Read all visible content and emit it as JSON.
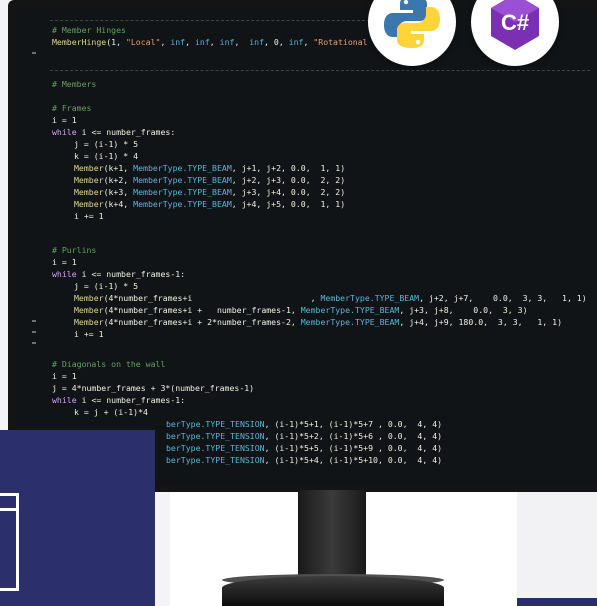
{
  "editor": {
    "lines": [
      {
        "parts": [
          {
            "cls": "c",
            "text": "# Member Hinges"
          }
        ]
      },
      {
        "parts": [
          {
            "cls": "f",
            "text": "MemberHinge"
          },
          {
            "cls": "v",
            "text": "(1, "
          },
          {
            "cls": "s",
            "text": "\"Local\""
          },
          {
            "cls": "v",
            "text": ", "
          },
          {
            "cls": "t",
            "text": "inf"
          },
          {
            "cls": "v",
            "text": ", "
          },
          {
            "cls": "t",
            "text": "inf"
          },
          {
            "cls": "v",
            "text": ", "
          },
          {
            "cls": "t",
            "text": "inf"
          },
          {
            "cls": "v",
            "text": ",  "
          },
          {
            "cls": "t",
            "text": "inf"
          },
          {
            "cls": "v",
            "text": ", 0, "
          },
          {
            "cls": "t",
            "text": "inf"
          },
          {
            "cls": "v",
            "text": ", "
          },
          {
            "cls": "s",
            "text": "\"Rotational            ly\""
          },
          {
            "cls": "v",
            "text": ")"
          }
        ]
      },
      {
        "parts": [
          {
            "cls": "c",
            "text": "# Members"
          }
        ]
      },
      {
        "parts": [
          {
            "cls": "c",
            "text": "# Frames"
          }
        ]
      },
      {
        "parts": [
          {
            "cls": "v",
            "text": "i = 1"
          }
        ]
      },
      {
        "parts": [
          {
            "cls": "k",
            "text": "while"
          },
          {
            "cls": "v",
            "text": " i <= number_frames:"
          }
        ]
      },
      {
        "parts": [
          {
            "cls": "v",
            "text": "j = (i-1) * 5"
          }
        ]
      },
      {
        "parts": [
          {
            "cls": "v",
            "text": "k = (i-1) * 4"
          }
        ]
      },
      {
        "parts": [
          {
            "cls": "f",
            "text": "Member"
          },
          {
            "cls": "v",
            "text": "(k+1, "
          },
          {
            "cls": "t",
            "text": "MemberType.TYPE_BEAM"
          },
          {
            "cls": "v",
            "text": ", j+1, j+2, 0.0,  1, 1)"
          }
        ]
      },
      {
        "parts": [
          {
            "cls": "f",
            "text": "Member"
          },
          {
            "cls": "v",
            "text": "(k+2, "
          },
          {
            "cls": "t",
            "text": "MemberType.TYPE_BEAM"
          },
          {
            "cls": "v",
            "text": ", j+2, j+3, 0.0,  2, 2)"
          }
        ]
      },
      {
        "parts": [
          {
            "cls": "f",
            "text": "Member"
          },
          {
            "cls": "v",
            "text": "(k+3, "
          },
          {
            "cls": "t",
            "text": "MemberType.TYPE_BEAM"
          },
          {
            "cls": "v",
            "text": ", j+3, j+4, 0.0,  2, 2)"
          }
        ]
      },
      {
        "parts": [
          {
            "cls": "f",
            "text": "Member"
          },
          {
            "cls": "v",
            "text": "(k+4, "
          },
          {
            "cls": "t",
            "text": "MemberType.TYPE_BEAM"
          },
          {
            "cls": "v",
            "text": ", j+4, j+5, 0.0,  1, 1)"
          }
        ]
      },
      {
        "parts": [
          {
            "cls": "v",
            "text": "i += 1"
          }
        ]
      },
      {
        "parts": [
          {
            "cls": "c",
            "text": "# Purlins"
          }
        ]
      },
      {
        "parts": [
          {
            "cls": "v",
            "text": "i = 1"
          }
        ]
      },
      {
        "parts": [
          {
            "cls": "k",
            "text": "while"
          },
          {
            "cls": "v",
            "text": " i <= number_frames-1:"
          }
        ]
      },
      {
        "parts": [
          {
            "cls": "v",
            "text": "j = (i-1) * 5"
          }
        ]
      },
      {
        "parts": [
          {
            "cls": "f",
            "text": "Member"
          },
          {
            "cls": "v",
            "text": "(4*number_frames+i                        , "
          },
          {
            "cls": "t",
            "text": "MemberType.TYPE_BEAM"
          },
          {
            "cls": "v",
            "text": ", j+2, j+7,    0.0,  3, 3,   1, 1)"
          }
        ]
      },
      {
        "parts": [
          {
            "cls": "f",
            "text": "Member"
          },
          {
            "cls": "v",
            "text": "(4*number_frames+i +   number_frames-1, "
          },
          {
            "cls": "t",
            "text": "MemberType.TYPE_BEAM"
          },
          {
            "cls": "v",
            "text": ", j+3, j+8,    0.0,  3, 3)"
          }
        ]
      },
      {
        "parts": [
          {
            "cls": "f",
            "text": "Member"
          },
          {
            "cls": "v",
            "text": "(4*number_frames+i + 2*number_frames-2, "
          },
          {
            "cls": "t",
            "text": "MemberType.TYPE_BEAM"
          },
          {
            "cls": "v",
            "text": ", j+4, j+9, 180.0,  3, 3,   1, 1)"
          }
        ]
      },
      {
        "parts": [
          {
            "cls": "v",
            "text": "i += 1"
          }
        ]
      },
      {
        "parts": [
          {
            "cls": "c",
            "text": "# Diagonals on the wall"
          }
        ]
      },
      {
        "parts": [
          {
            "cls": "v",
            "text": "i = 1"
          }
        ]
      },
      {
        "parts": [
          {
            "cls": "v",
            "text": "j = 4*number_frames + 3*(number_frames-1)"
          }
        ]
      },
      {
        "parts": [
          {
            "cls": "k",
            "text": "while"
          },
          {
            "cls": "v",
            "text": " i <= number_frames-1:"
          }
        ]
      },
      {
        "parts": [
          {
            "cls": "v",
            "text": "k = j + (i-1)*4"
          }
        ]
      },
      {
        "parts": [
          {
            "cls": "t",
            "text": "berType.TYPE_TENSION"
          },
          {
            "cls": "v",
            "text": ", (i-1)*5+1, (i-1)*5+7 , 0.0,  4, 4)"
          }
        ]
      },
      {
        "parts": [
          {
            "cls": "t",
            "text": "berType.TYPE_TENSION"
          },
          {
            "cls": "v",
            "text": ", (i-1)*5+2, (i-1)*5+6 , 0.0,  4, 4)"
          }
        ]
      },
      {
        "parts": [
          {
            "cls": "t",
            "text": "berType.TYPE_TENSION"
          },
          {
            "cls": "v",
            "text": ", (i-1)*5+5, (i-1)*5+9 , 0.0,  4, 4)"
          }
        ]
      },
      {
        "parts": [
          {
            "cls": "t",
            "text": "berType.TYPE_TENSION"
          },
          {
            "cls": "v",
            "text": ", (i-1)*5+4, (i-1)*5+10, 0.0,  4, 4)"
          }
        ]
      }
    ]
  },
  "badges": {
    "python": {
      "icon": "python-logo-icon",
      "colors": [
        "#3b76ad",
        "#ffd43b"
      ]
    },
    "csharp": {
      "icon": "csharp-logo-icon",
      "label": "C#",
      "color": "#7b2fb3"
    }
  }
}
